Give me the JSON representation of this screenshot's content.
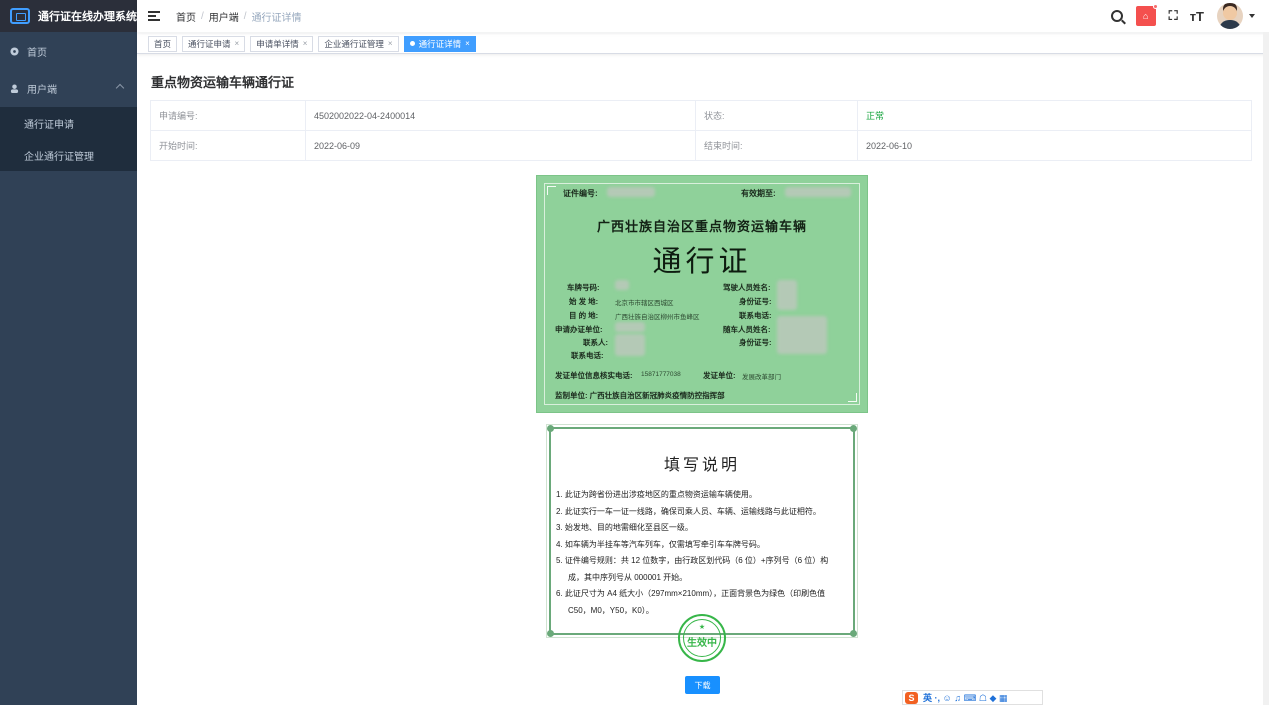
{
  "app": {
    "title": "通行证在线办理系统"
  },
  "sidebar": {
    "items": [
      {
        "label": "首页"
      },
      {
        "label": "用户端"
      }
    ],
    "submenu": [
      {
        "label": "通行证申请"
      },
      {
        "label": "企业通行证管理"
      }
    ]
  },
  "breadcrumb": {
    "home": "首页",
    "section": "用户端",
    "current": "通行证详情"
  },
  "header": {
    "home_badge": "⌂",
    "fullscreen": "⛶",
    "size": "тT"
  },
  "tags": [
    {
      "label": "首页"
    },
    {
      "label": "通行证申请"
    },
    {
      "label": "申请单详情"
    },
    {
      "label": "企业通行证管理"
    },
    {
      "label": "通行证详情"
    }
  ],
  "page": {
    "title": "重点物资运输车辆通行证"
  },
  "details": {
    "apply_no_label": "申请编号:",
    "apply_no": "4502002022-04-2400014",
    "status_label": "状态:",
    "status": "正常",
    "start_label": "开始时间:",
    "start": "2022-06-09",
    "end_label": "结束时间:",
    "end": "2022-06-10"
  },
  "certificate": {
    "cert_no_label": "证件编号:",
    "valid_label": "有效期至:",
    "title": "广西壮族自治区重点物资运输车辆",
    "big": "通行证",
    "plate_label": "车牌号码:",
    "origin_label": "始 发 地:",
    "origin": "北京市市辖区西城区",
    "dest_label": "目 的 地:",
    "dest": "广西壮族自治区柳州市鱼峰区",
    "unit_label": "申请办证单位:",
    "contact_label": "联系人:",
    "phone_label": "联系电话:",
    "driver_label": "驾驶人员姓名:",
    "id_label": "身份证号:",
    "driver_phone_label": "联系电话:",
    "passenger_label": "随车人员姓名:",
    "passenger_id_label": "身份证号:",
    "verify_phone_label": "发证单位信息核实电话:",
    "verify_phone": "15871777038",
    "issuer_label": "发证单位:",
    "issuer": "发展改革部门",
    "supervisor": "监制单位: 广西壮族自治区新冠肺炎疫情防控指挥部"
  },
  "instructions": {
    "title": "填写说明",
    "items": [
      "1. 此证为跨省份进出涉疫地区的重点物资运输车辆使用。",
      "2. 此证实行一车一证一线路，确保司乘人员、车辆、运输线路与此证相符。",
      "3. 始发地、目的地需细化至县区一级。",
      "4. 如车辆为半挂车等汽车列车，仅需填写牵引车车牌号码。",
      "5. 证件编号规则：共 12 位数字，由行政区划代码（6 位）+序列号（6 位）构",
      "成，其中序列号从 000001 开始。",
      "6. 此证尺寸为 A4 纸大小（297mm×210mm），正面背景色为绿色（印刷色值",
      "C50，M0，Y50，K0）。"
    ]
  },
  "stamp": {
    "text": "生效中"
  },
  "download": {
    "label": "下载"
  },
  "ime": {
    "logo": "S",
    "lang": "英 ·, ☺ ♫ ⌨ ☖ ◆ ▦"
  }
}
